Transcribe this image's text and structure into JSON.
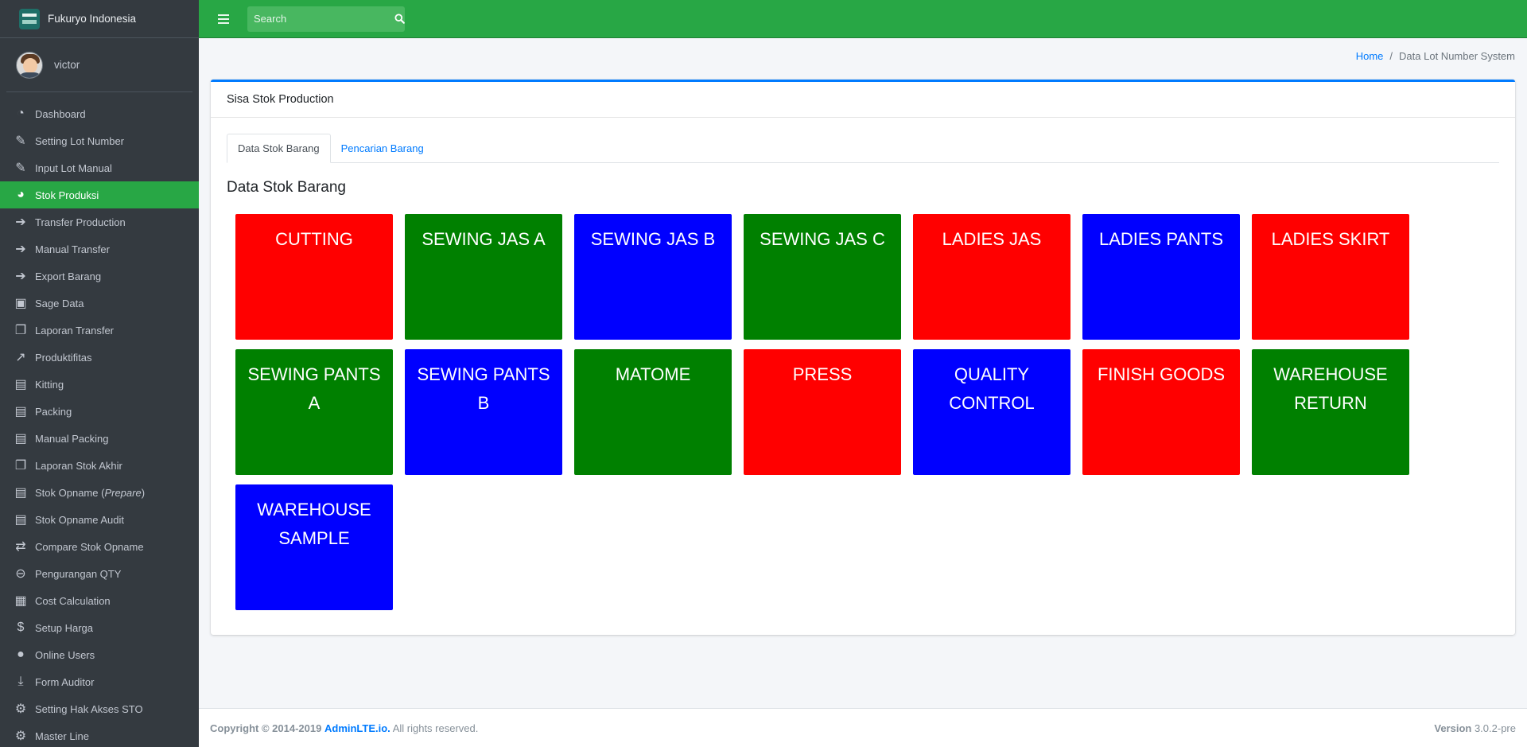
{
  "brand": {
    "name": "Fukuryo Indonesia"
  },
  "user": {
    "name": "victor"
  },
  "sidebar": {
    "items": [
      {
        "label": "Dashboard",
        "icon": "dashboard-icon",
        "glyph": "◔"
      },
      {
        "label": "Setting Lot Number",
        "icon": "edit-icon",
        "glyph": "✎"
      },
      {
        "label": "Input Lot Manual",
        "icon": "edit-icon",
        "glyph": "✎"
      },
      {
        "label": "Stok Produksi",
        "icon": "pie-chart-icon",
        "glyph": "◕",
        "active": true
      },
      {
        "label": "Transfer Production",
        "icon": "arrow-right-icon",
        "glyph": "➔"
      },
      {
        "label": "Manual Transfer",
        "icon": "arrow-right-icon",
        "glyph": "➔"
      },
      {
        "label": "Export Barang",
        "icon": "arrow-right-icon",
        "glyph": "➔"
      },
      {
        "label": "Sage Data",
        "icon": "briefcase-icon",
        "glyph": "▣"
      },
      {
        "label": "Laporan Transfer",
        "icon": "copy-icon",
        "glyph": "❐"
      },
      {
        "label": "Produktifitas",
        "icon": "line-chart-icon",
        "glyph": "↗"
      },
      {
        "label": "Kitting",
        "icon": "box-icon",
        "glyph": "▤"
      },
      {
        "label": "Packing",
        "icon": "box-icon",
        "glyph": "▤"
      },
      {
        "label": "Manual Packing",
        "icon": "box-icon",
        "glyph": "▤"
      },
      {
        "label": "Laporan Stok Akhir",
        "icon": "copy-icon",
        "glyph": "❐"
      },
      {
        "label_prefix": "Stok Opname (",
        "label_em": "Prepare",
        "label_suffix": ")",
        "icon": "box-icon",
        "glyph": "▤"
      },
      {
        "label": "Stok Opname Audit",
        "icon": "box-icon",
        "glyph": "▤"
      },
      {
        "label": "Compare Stok Opname",
        "icon": "exchange-icon",
        "glyph": "⇄"
      },
      {
        "label": "Pengurangan QTY",
        "icon": "minus-circle-icon",
        "glyph": "⊖"
      },
      {
        "label": "Cost Calculation",
        "icon": "calculator-icon",
        "glyph": "▦"
      },
      {
        "label": "Setup Harga",
        "icon": "dollar-icon",
        "glyph": "$"
      },
      {
        "label": "Online Users",
        "icon": "user-icon",
        "glyph": "●"
      },
      {
        "label": "Form Auditor",
        "icon": "download-icon",
        "glyph": "⤓"
      },
      {
        "label": "Setting Hak Akses STO",
        "icon": "gear-icon",
        "glyph": "⚙"
      },
      {
        "label": "Master Line",
        "icon": "gear-icon",
        "glyph": "⚙"
      }
    ]
  },
  "search": {
    "placeholder": "Search"
  },
  "breadcrumb": {
    "home": "Home",
    "separator": "/",
    "current": "Data Lot Number System"
  },
  "card": {
    "title": "Sisa Stok Production"
  },
  "tabs": [
    {
      "label": "Data Stok Barang",
      "active": true
    },
    {
      "label": "Pencarian Barang",
      "active": false
    }
  ],
  "section": {
    "title": "Data Stok Barang"
  },
  "tiles": [
    {
      "label": "CUTTING",
      "color": "#ff0000"
    },
    {
      "label": "SEWING JAS A",
      "color": "#008000"
    },
    {
      "label": "SEWING JAS B",
      "color": "#0000ff"
    },
    {
      "label": "SEWING JAS C",
      "color": "#008000"
    },
    {
      "label": "LADIES JAS",
      "color": "#ff0000"
    },
    {
      "label": "LADIES PANTS",
      "color": "#0000ff"
    },
    {
      "label": "LADIES SKIRT",
      "color": "#ff0000"
    },
    {
      "label": "SEWING PANTS A",
      "color": "#008000"
    },
    {
      "label": "SEWING PANTS B",
      "color": "#0000ff"
    },
    {
      "label": "MATOME",
      "color": "#008000"
    },
    {
      "label": "PRESS",
      "color": "#ff0000"
    },
    {
      "label": "QUALITY CONTROL",
      "color": "#0000ff"
    },
    {
      "label": "FINISH GOODS",
      "color": "#ff0000"
    },
    {
      "label": "WAREHOUSE RETURN",
      "color": "#008000"
    },
    {
      "label": "WAREHOUSE SAMPLE",
      "color": "#0000ff"
    }
  ],
  "footer": {
    "copyright": "Copyright © 2014-2019",
    "link": "AdminLTE.io.",
    "rights": "All rights reserved.",
    "version_label": "Version",
    "version_value": "3.0.2-pre"
  },
  "colors": {
    "header": "#28a745",
    "sidebar": "#343a40",
    "active": "#28a745",
    "link": "#007bff"
  }
}
